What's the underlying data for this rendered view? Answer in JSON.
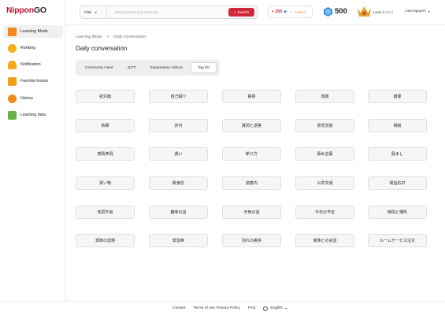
{
  "brand": {
    "part1": "Nippon",
    "part2": "GO"
  },
  "sidebar": {
    "items": [
      {
        "label": "Learning Mode",
        "icon": "learning-mode-icon",
        "color": "#f08a1c",
        "active": true
      },
      {
        "label": "Ranking",
        "icon": "ranking-icon",
        "color": "#f2b01c"
      },
      {
        "label": "Notification",
        "icon": "notification-icon",
        "color": "#f2a91c"
      },
      {
        "label": "Favorite lesson",
        "icon": "favorite-lesson-icon",
        "color": "#f0a01c"
      },
      {
        "label": "History",
        "icon": "history-icon",
        "color": "#f08a1c"
      },
      {
        "label": "Learning data",
        "icon": "learning-data-icon",
        "color": "#6cb04a"
      }
    ]
  },
  "topbar": {
    "filter_label": "Filter",
    "search_placeholder": "Enter keyword and search by...",
    "search_button": "Search",
    "points_plus": "+ 200",
    "points_level": "Level 2",
    "gems": "500",
    "level_label": "Level 2",
    "level_plan": "(Pro)",
    "user_name": "Lisa Nguyen"
  },
  "breadcrumb": {
    "root": "Learning Mode",
    "sep": ">",
    "current": "Daily conversation"
  },
  "page_title": "Daily conversation",
  "tabs": [
    {
      "label": "Commonly Used"
    },
    {
      "label": "JLPT"
    },
    {
      "label": "Explanatory Videos"
    },
    {
      "label": "Tag list",
      "active": true
    }
  ],
  "tags": [
    [
      "初対面",
      "自己紹介",
      "挨拶",
      "感謝",
      "謝罪"
    ],
    [
      "依頼",
      "許可",
      "質問と返答",
      "意見交換",
      "相槌"
    ],
    [
      "感情表現",
      "誘い",
      "断り方",
      "褒め言葉",
      "励まし"
    ],
    [
      "買い物",
      "飲食店",
      "道案内",
      "公共交通",
      "電話応対"
    ],
    [
      "体調不良",
      "趣味の話",
      "天気の話",
      "今日の予定",
      "時間と場所"
    ],
    [
      "季節の話題",
      "緊急時",
      "別れの挨拶",
      "家族との会話",
      "ルームサービス注文"
    ]
  ],
  "footer": {
    "contact": "Contact",
    "terms": "Terms of use",
    "privacy": "Privacy Policy",
    "faq": "FAQ",
    "language": "English"
  },
  "colors": {
    "brand_red": "#d0283a",
    "accent_orange": "#f08a1c",
    "gem_blue": "#3a8fd8"
  }
}
